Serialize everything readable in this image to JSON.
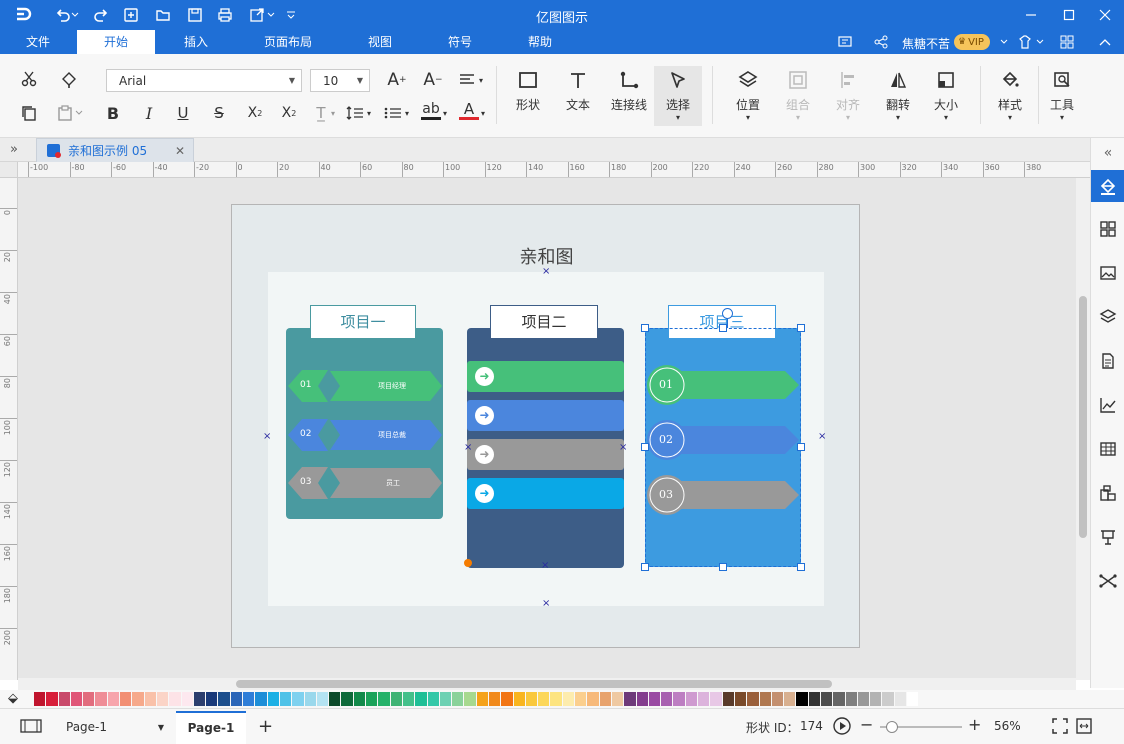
{
  "app": {
    "title": "亿图图示"
  },
  "menu": {
    "items": [
      "文件",
      "开始",
      "插入",
      "页面布局",
      "视图",
      "符号",
      "帮助"
    ],
    "active_index": 1
  },
  "user": {
    "name": "焦糖不苦",
    "badge": "VIP"
  },
  "ribbon": {
    "font_name": "Arial",
    "font_size": "10",
    "groups": {
      "shape": "形状",
      "text": "文本",
      "connector": "连接线",
      "select": "选择",
      "position": "位置",
      "group": "组合",
      "align": "对齐",
      "flip": "翻转",
      "size": "大小",
      "style": "样式",
      "tools": "工具"
    }
  },
  "doc_tab": {
    "label": "亲和图示例 05"
  },
  "ruler": {
    "h_ticks": [
      "-100",
      "-80",
      "-60",
      "-40",
      "-20",
      "0",
      "20",
      "40",
      "60",
      "80",
      "100",
      "120",
      "140",
      "160",
      "180",
      "200",
      "220",
      "240",
      "260",
      "280",
      "300",
      "320",
      "340",
      "360",
      "380"
    ],
    "v_ticks": [
      "0",
      "20",
      "40",
      "60",
      "80",
      "100",
      "120",
      "140",
      "160",
      "180",
      "200"
    ]
  },
  "diagram": {
    "title": "亲和图",
    "columns": [
      {
        "header": "项目一",
        "color": "#4a9aa0",
        "items": [
          {
            "num": "01",
            "text": "项目经理",
            "color": "#46c07a"
          },
          {
            "num": "02",
            "text": "项目总裁",
            "color": "#4b86dd"
          },
          {
            "num": "03",
            "text": "员工",
            "color": "#999999"
          }
        ]
      },
      {
        "header": "项目二",
        "color": "#3d5d87",
        "bars": [
          "#46c07a",
          "#4b86dd",
          "#999999",
          "#0aa8e6"
        ]
      },
      {
        "header": "项目三",
        "color": "#3d9be0",
        "items": [
          {
            "num": "01",
            "color": "#46c07a"
          },
          {
            "num": "02",
            "color": "#4b86dd"
          },
          {
            "num": "03",
            "color": "#999999"
          }
        ]
      }
    ]
  },
  "palette": [
    "#c0152e",
    "#d81e3a",
    "#c94a6b",
    "#e05678",
    "#e26d7e",
    "#ef8d97",
    "#f7a5ac",
    "#f28f74",
    "#f6a98b",
    "#f9c1a9",
    "#fbd4c7",
    "#fde3e7",
    "#fde8ef",
    "#2c3e6e",
    "#1a3a7a",
    "#1d4f8d",
    "#2b66b8",
    "#2f7ed8",
    "#1d8ed8",
    "#1cb0e5",
    "#4fc2e8",
    "#7fd1ef",
    "#9ad8ec",
    "#b4e3f2",
    "#0c4a2a",
    "#0e6a3a",
    "#128a4a",
    "#1ba35a",
    "#26b26a",
    "#3fb374",
    "#44c08a",
    "#1fbf96",
    "#34c8a8",
    "#6dd1b3",
    "#8ad29a",
    "#a7d98f",
    "#f5a21a",
    "#f18a1c",
    "#f27514",
    "#f9b51f",
    "#fac83c",
    "#fcd75a",
    "#fde480",
    "#fdecad",
    "#fbcf8e",
    "#f7b97a",
    "#e8a36d",
    "#efc9a2",
    "#6e3a7a",
    "#843d8e",
    "#9a4aa3",
    "#a860b0",
    "#bd7ec2",
    "#cf9ad0",
    "#dcb3dc",
    "#e8c8e6",
    "#5a3b2a",
    "#7a4a2a",
    "#9a5f3a",
    "#b07850",
    "#c49070",
    "#d8b090",
    "#000000",
    "#333333",
    "#4d4d4d",
    "#666666",
    "#808080",
    "#999999",
    "#b3b3b3",
    "#cccccc",
    "#e6e6e6",
    "#ffffff"
  ],
  "status": {
    "page_selector": "Page-1",
    "page_tab": "Page-1",
    "shape_id_label": "形状 ID：",
    "shape_id": "174",
    "zoom": "56%"
  }
}
